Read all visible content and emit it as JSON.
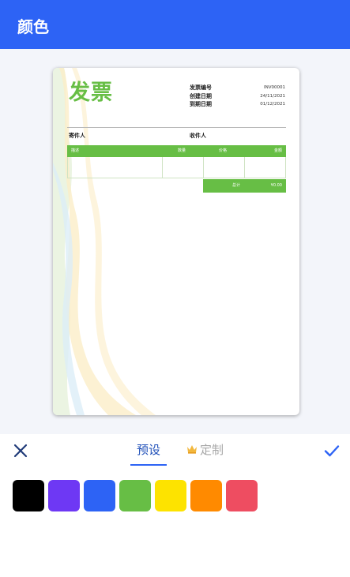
{
  "app_bar": {
    "title": "颜色"
  },
  "invoice": {
    "title": "发票",
    "meta": [
      {
        "label": "发票编号",
        "value": "INV00001"
      },
      {
        "label": "创建日期",
        "value": "24/11/2021"
      },
      {
        "label": "到期日期",
        "value": "01/12/2021"
      }
    ],
    "sender_label": "寄件人",
    "recipient_label": "收件人",
    "table_headers": {
      "description": "描述",
      "quantity": "数量",
      "price": "价格",
      "amount": "金额"
    },
    "total_label": "总计",
    "total_value": "¥0.00",
    "accent_color": "#67be45"
  },
  "tabs": {
    "preset_label": "预设",
    "custom_label": "定制",
    "active": "preset",
    "close_icon": "close-icon",
    "confirm_icon": "check-icon",
    "crown_icon": "crown-icon"
  },
  "swatches": [
    {
      "name": "black",
      "color": "#000000"
    },
    {
      "name": "purple",
      "color": "#6e38f4"
    },
    {
      "name": "blue",
      "color": "#2d63f5"
    },
    {
      "name": "green",
      "color": "#67be45"
    },
    {
      "name": "yellow",
      "color": "#fde300"
    },
    {
      "name": "orange",
      "color": "#ff8a00"
    },
    {
      "name": "red",
      "color": "#ee4d61"
    }
  ]
}
